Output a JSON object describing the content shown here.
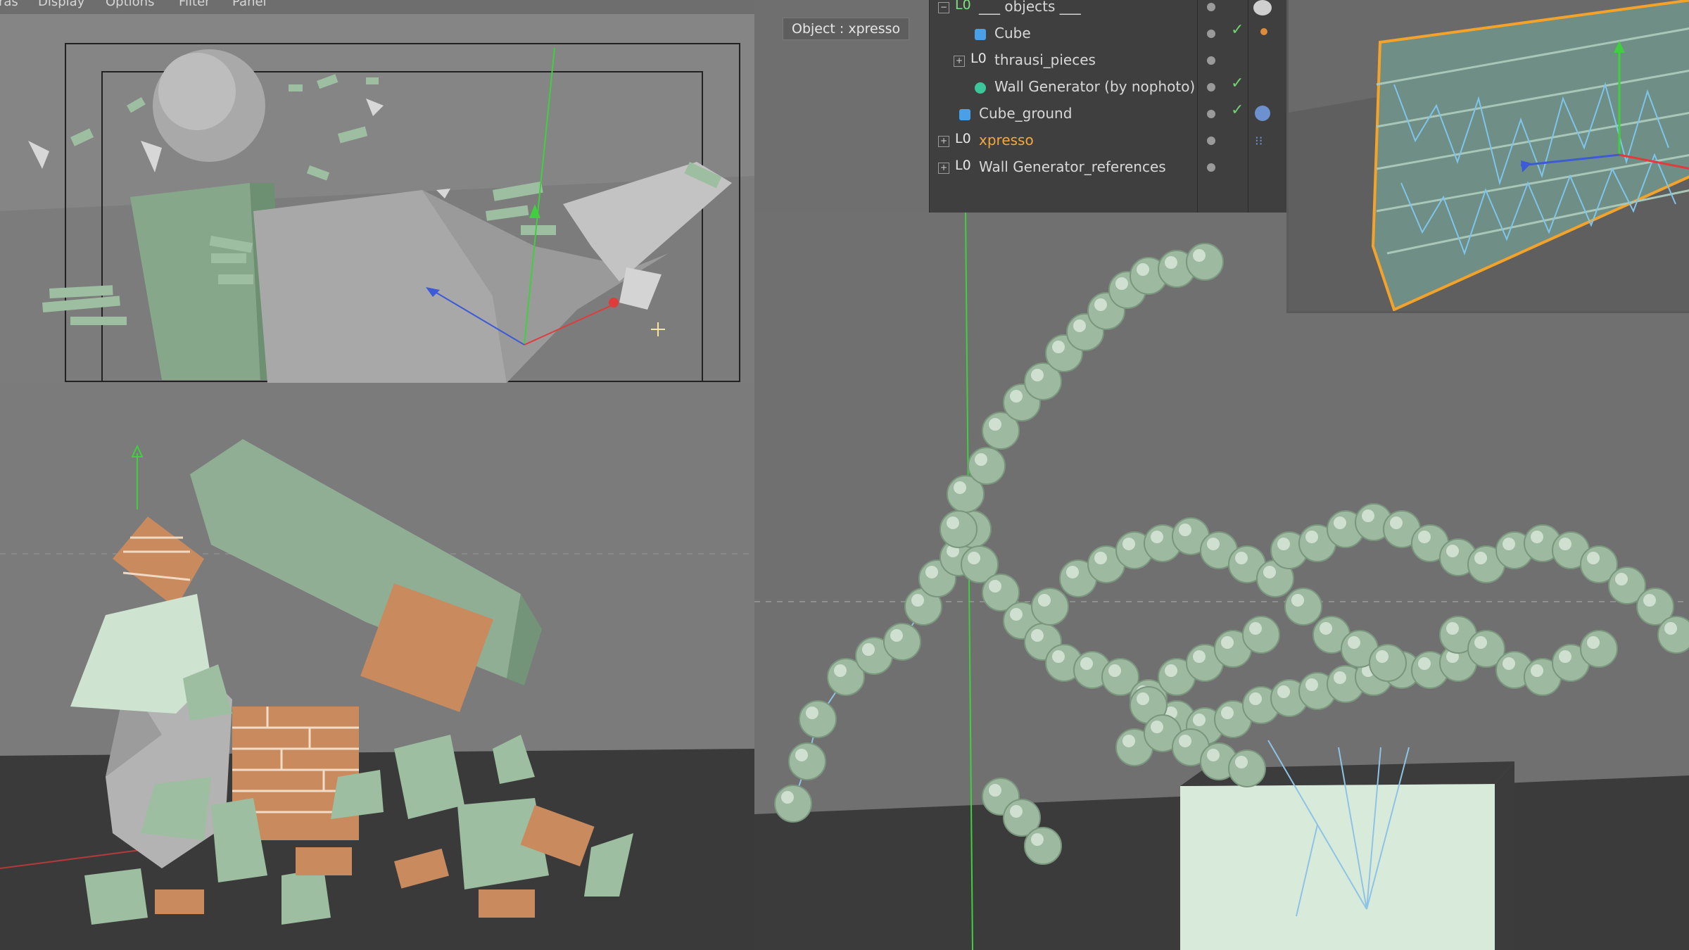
{
  "menu": {
    "items": [
      "ras",
      "Display",
      "Options",
      "Filter",
      "Panel"
    ]
  },
  "viewport_label": "Object : xpresso",
  "object_manager": {
    "rows": [
      {
        "name": "___ objects ___",
        "icon": "null-icon",
        "tree": "collapse",
        "checked": false,
        "selected": false
      },
      {
        "name": "Cube",
        "icon": "cube-icon",
        "tree": "none",
        "checked": true,
        "selected": false
      },
      {
        "name": "thrausi_pieces",
        "icon": "null-icon",
        "tree": "expand",
        "checked": false,
        "selected": false
      },
      {
        "name": "Wall Generator (by nophoto)",
        "icon": "python-icon",
        "tree": "none",
        "checked": true,
        "selected": false
      },
      {
        "name": "Cube_ground",
        "icon": "cube-icon",
        "tree": "none",
        "checked": true,
        "selected": false
      },
      {
        "name": "xpresso",
        "icon": "null-icon",
        "tree": "expand",
        "checked": false,
        "selected": true
      },
      {
        "name": "Wall Generator_references",
        "icon": "null-icon",
        "tree": "expand",
        "checked": false,
        "selected": false
      }
    ]
  },
  "colors": {
    "selected_text": "#f2a93b",
    "mint_object": "#8fae94",
    "brick": "#c98a5e",
    "orange_highlight": "#f3a32a",
    "axis_x": "#e23b3b",
    "axis_y": "#3fcf3f",
    "axis_z": "#3d5bd6"
  }
}
